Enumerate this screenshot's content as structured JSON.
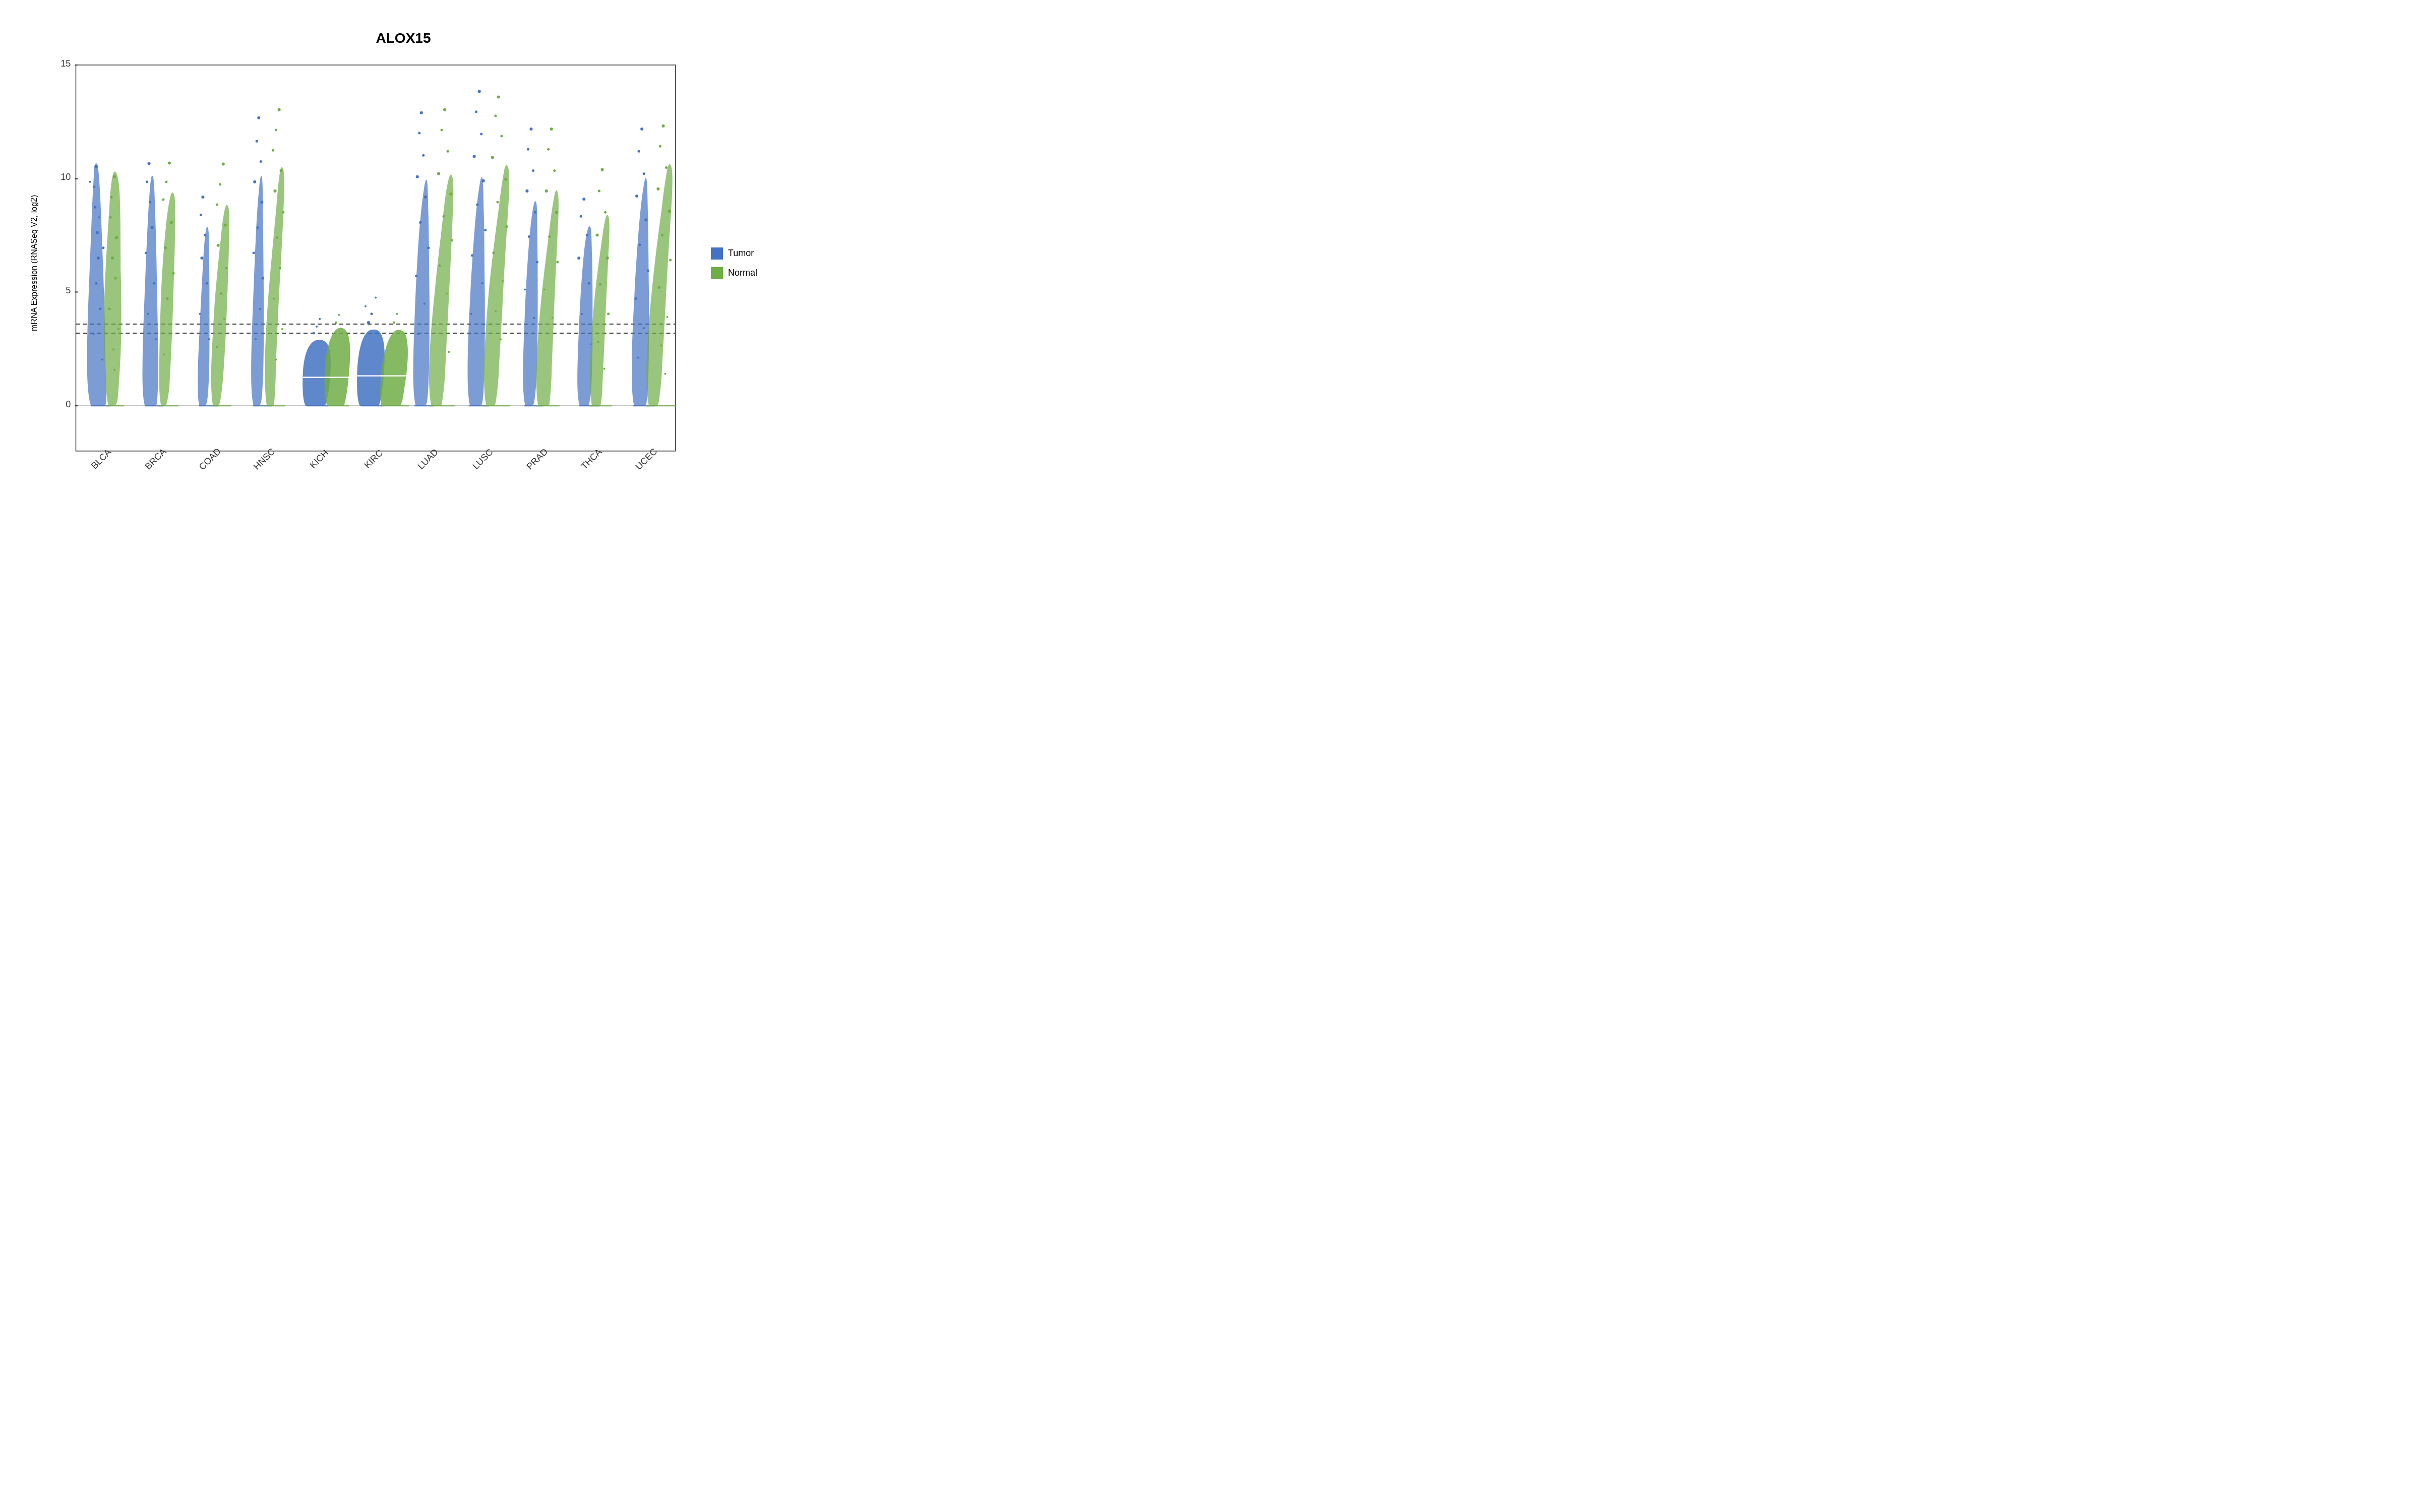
{
  "title": "ALOX15",
  "yAxisLabel": "mRNA Expression (RNASeq V2, log2)",
  "yAxis": {
    "min": -2,
    "max": 15,
    "ticks": [
      0,
      5,
      10,
      15
    ]
  },
  "xAxis": {
    "labels": [
      "BLCA",
      "BRCA",
      "COAD",
      "HNSC",
      "KICH",
      "KIRC",
      "LUAD",
      "LUSC",
      "PRAD",
      "THCA",
      "UCEC"
    ]
  },
  "dotLines": [
    3.2,
    3.6
  ],
  "colors": {
    "tumor": "#4472C4",
    "normal": "#70AD47"
  },
  "legend": {
    "items": [
      {
        "label": "Tumor",
        "color": "#4472C4"
      },
      {
        "label": "Normal",
        "color": "#70AD47"
      }
    ]
  }
}
